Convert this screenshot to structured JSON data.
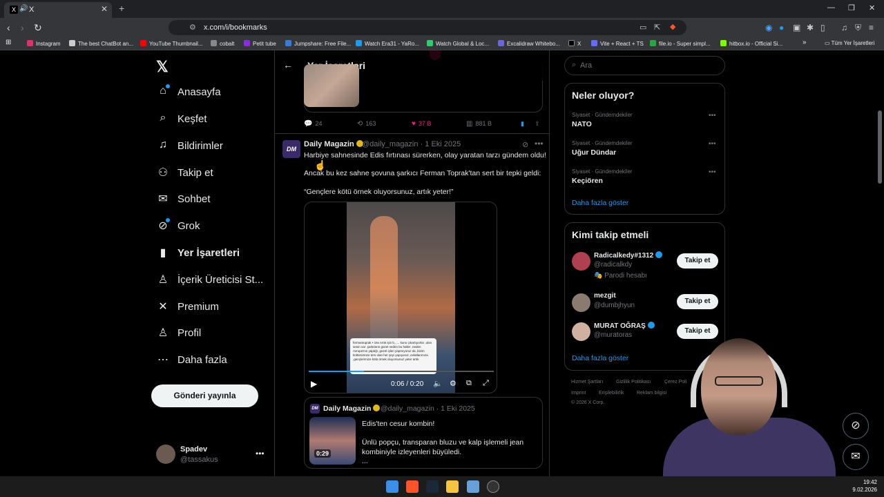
{
  "browser": {
    "tab_title": "X",
    "tab_favicon": "X",
    "url": "x.com/i/bookmarks",
    "bookmarks": [
      {
        "label": "Instagram",
        "color": "#e1306c"
      },
      {
        "label": "The best ChatBot an...",
        "color": "#cccccc"
      },
      {
        "label": "YouTube Thumbnail...",
        "color": "#ff0000"
      },
      {
        "label": "cobalt",
        "color": "#888888"
      },
      {
        "label": "Petit tube",
        "color": "#8a2be2"
      },
      {
        "label": "Jumpshare: Free File...",
        "color": "#3a7bd5"
      },
      {
        "label": "Watch Era31 - YaRo...",
        "color": "#1d9bf0"
      },
      {
        "label": "Watch Global & Loc...",
        "color": "#2ecc71"
      },
      {
        "label": "Excalidraw Whitebo...",
        "color": "#6965db"
      },
      {
        "label": "X",
        "color": "#000000"
      },
      {
        "label": "Vite + React + TS",
        "color": "#646cff"
      },
      {
        "label": "file.io - Super simpl...",
        "color": "#28a745"
      },
      {
        "label": "hitbox.io - Official Si...",
        "color": "#7cfc00"
      }
    ],
    "all_bookmarks_label": "Tüm Yer İşaretleri"
  },
  "sidebar": {
    "items": [
      {
        "label": "Anasayfa",
        "icon": "home-icon",
        "glyph": "⌂",
        "dot": true
      },
      {
        "label": "Keşfet",
        "icon": "search-icon",
        "glyph": "⌕"
      },
      {
        "label": "Bildirimler",
        "icon": "bell-icon",
        "glyph": "♫"
      },
      {
        "label": "Takip et",
        "icon": "person-add-icon",
        "glyph": "⚇"
      },
      {
        "label": "Sohbet",
        "icon": "mail-icon",
        "glyph": "✉"
      },
      {
        "label": "Grok",
        "icon": "grok-icon",
        "glyph": "⊘",
        "dot": true
      },
      {
        "label": "Yer İşaretleri",
        "icon": "bookmark-icon",
        "glyph": "▮",
        "active": true
      },
      {
        "label": "İçerik Üreticisi St...",
        "icon": "creator-icon",
        "glyph": "♙"
      },
      {
        "label": "Premium",
        "icon": "x-icon",
        "glyph": "✕"
      },
      {
        "label": "Profil",
        "icon": "profile-icon",
        "glyph": "♙"
      },
      {
        "label": "Daha fazla",
        "icon": "more-icon",
        "glyph": "⋯"
      }
    ],
    "post_button": "Gönderi yayınla",
    "user": {
      "name": "Spadev",
      "handle": "@tassakus"
    }
  },
  "main": {
    "title": "Yer İşaretleri",
    "prev_actions": {
      "replies": "24",
      "reposts": "163",
      "likes": "37 B",
      "views": "881 B"
    },
    "post": {
      "avatar_text": "DM",
      "author": "Daily Magazin",
      "handle": "@daily_magazin",
      "date": "· 1 Eki 2025",
      "line1": "Harbiye sahnesinde Edis fırtınası sürerken, olay yaratan tarzı gündem oldu!",
      "line2": "Ancak bu kez sahne şovuna şarkıcı Ferman Toprak'tan sert bir tepki geldi:",
      "line3": "“Gençlere kötü örnek oluyorsunuz, artık yeter!”",
      "video_time": "0:06 / 0:20",
      "video_progress": 0.3,
      "overlay_text": "fermantoprak • 15s Artık işin b...... kunu çıkartıyorlar ,ulan senin var ,şarkıların güzel neden bu haller ,neden Avrupa'nın yaptığı ,güzel işleri yapmıyoruz da ,bizim kültürümüze ters olan her şeyi yapıyoruz ,evlatlarımıza ,gençlerimize kötü örnek oluyorsunuz yeter artık"
    },
    "quote": {
      "avatar_text": "DM",
      "author": "Daily Magazin",
      "handle": "@daily_magazin",
      "date": "· 1 Eki 2025",
      "duration": "0:29",
      "line1": "Edis'ten cesur kombin!",
      "line2": "Ünlü popçu, transparan bluzu ve kalp işlemeli jean",
      "line3": "kombiniyle izleyenleri büyüledi.",
      "line4": "..."
    }
  },
  "right": {
    "search_placeholder": "Ara",
    "trends_title": "Neler oluyor?",
    "trends": [
      {
        "category": "Siyaset · Gündemdekiler",
        "name": "NATO"
      },
      {
        "category": "Siyaset · Gündemdekiler",
        "name": "Uğur Dündar"
      },
      {
        "category": "Siyaset · Gündemdekiler",
        "name": "Keçiören"
      }
    ],
    "trends_more": "Daha fazla göster",
    "who_title": "Kimi takip etmeli",
    "who": [
      {
        "name": "Radicalkedy#1312",
        "handle": "@radicalkdy",
        "badge": "🎭 Parodi hesabı",
        "verified": true,
        "color": "#b04050"
      },
      {
        "name": "mezgit",
        "handle": "@dumbjhyun",
        "verified": false,
        "color": "#8a7a70"
      },
      {
        "name": "MURAT OĞRAŞ",
        "handle": "@muratoras",
        "verified": true,
        "color": "#d0b0a0"
      }
    ],
    "follow_label": "Takip et",
    "who_more": "Daha fazla göster",
    "footer_links": [
      "Hizmet Şartları",
      "Gizlilik Politikası",
      "Çerez Poli"
    ],
    "footer_links2": [
      "Imprint",
      "Erişilebilirlik",
      "Reklam bilgisi"
    ],
    "copyright": "© 2026 X Corp."
  },
  "taskbar": {
    "time": "19:42",
    "date": "9.02.2026"
  }
}
